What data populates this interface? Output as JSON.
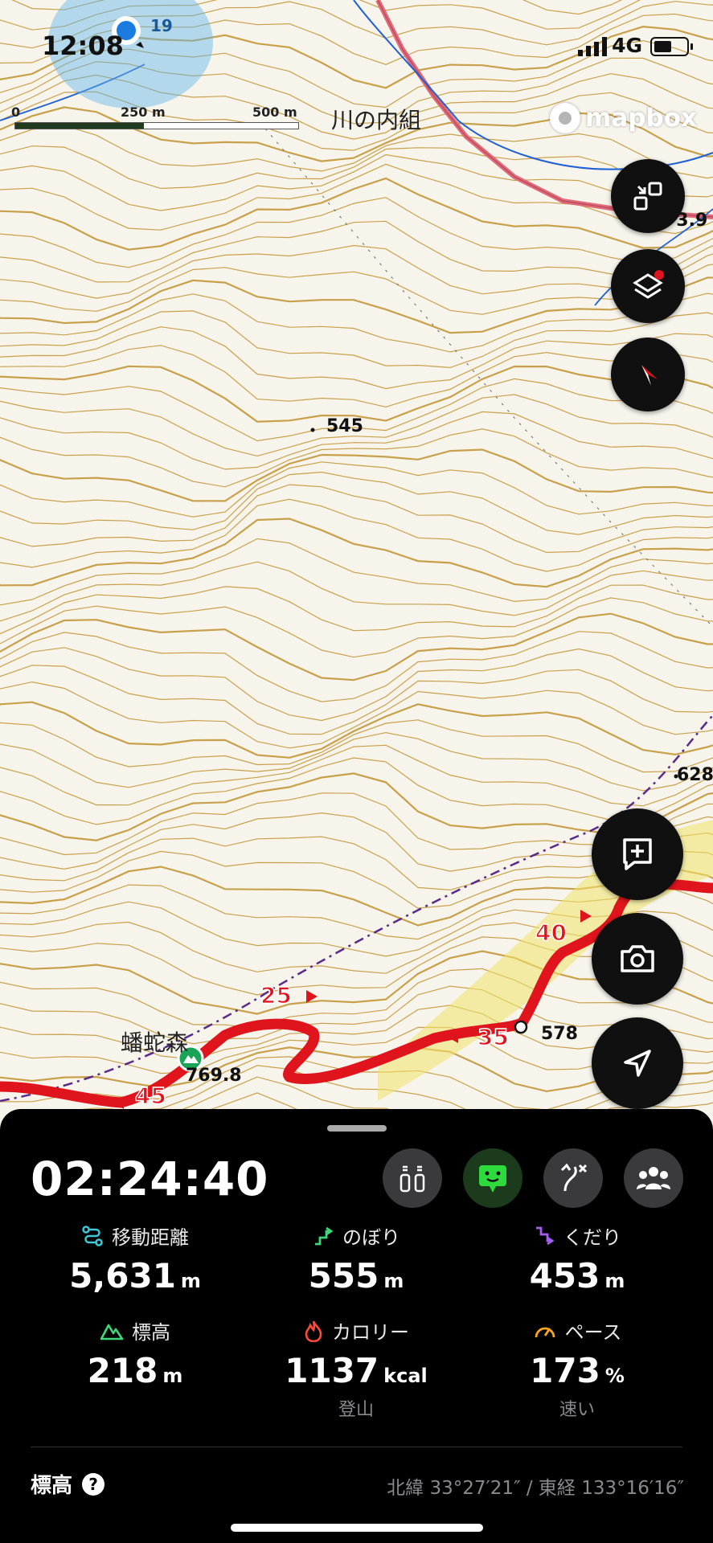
{
  "status_bar": {
    "time": "12:08",
    "network": "4G",
    "signal_bars": 4,
    "battery_level": 0.55
  },
  "map": {
    "location_accuracy_label": "19",
    "scale": {
      "zero": "0",
      "mid": "250 m",
      "end": "500 m"
    },
    "attribution": "mapbox",
    "place_labels": {
      "kawanouchi": "川の内組",
      "banja": "蟠蛇森"
    },
    "elevation_labels": {
      "peak_545": "545",
      "peak_628": "628",
      "peak_578": "578",
      "summit": "769.8",
      "edge": "73.9"
    },
    "route_markers": [
      "25",
      "35",
      "40",
      "45"
    ],
    "colors": {
      "route": "#e0141c",
      "contour": "#c9a04a",
      "river": "#1f5fd4",
      "road": "#e06a78",
      "trail": "#5a2a8a",
      "highlight": "#f1e36a"
    }
  },
  "map_controls": [
    "collapse-button",
    "layers-button",
    "compass-button",
    "add-note-button",
    "camera-button",
    "locate-button"
  ],
  "panel": {
    "elapsed_time": "02:24:40",
    "controls": [
      "tracker-icon",
      "chat-bubble-icon",
      "route-icon",
      "group-icon"
    ],
    "stats": {
      "distance": {
        "label": "移動距離",
        "value": "5,631",
        "unit": "m"
      },
      "ascent": {
        "label": "のぼり",
        "value": "555",
        "unit": "m"
      },
      "descent": {
        "label": "くだり",
        "value": "453",
        "unit": "m"
      },
      "elevation": {
        "label": "標高",
        "value": "218",
        "unit": "m"
      },
      "calories": {
        "label": "カロリー",
        "value": "1137",
        "unit": "kcal",
        "sub": "登山"
      },
      "pace": {
        "label": "ペース",
        "value": "173",
        "unit": "%",
        "sub": "速い"
      }
    },
    "elevation_section_label": "標高",
    "coordinates": "北緯 33°27′21″ / 東経 133°16′16″"
  }
}
